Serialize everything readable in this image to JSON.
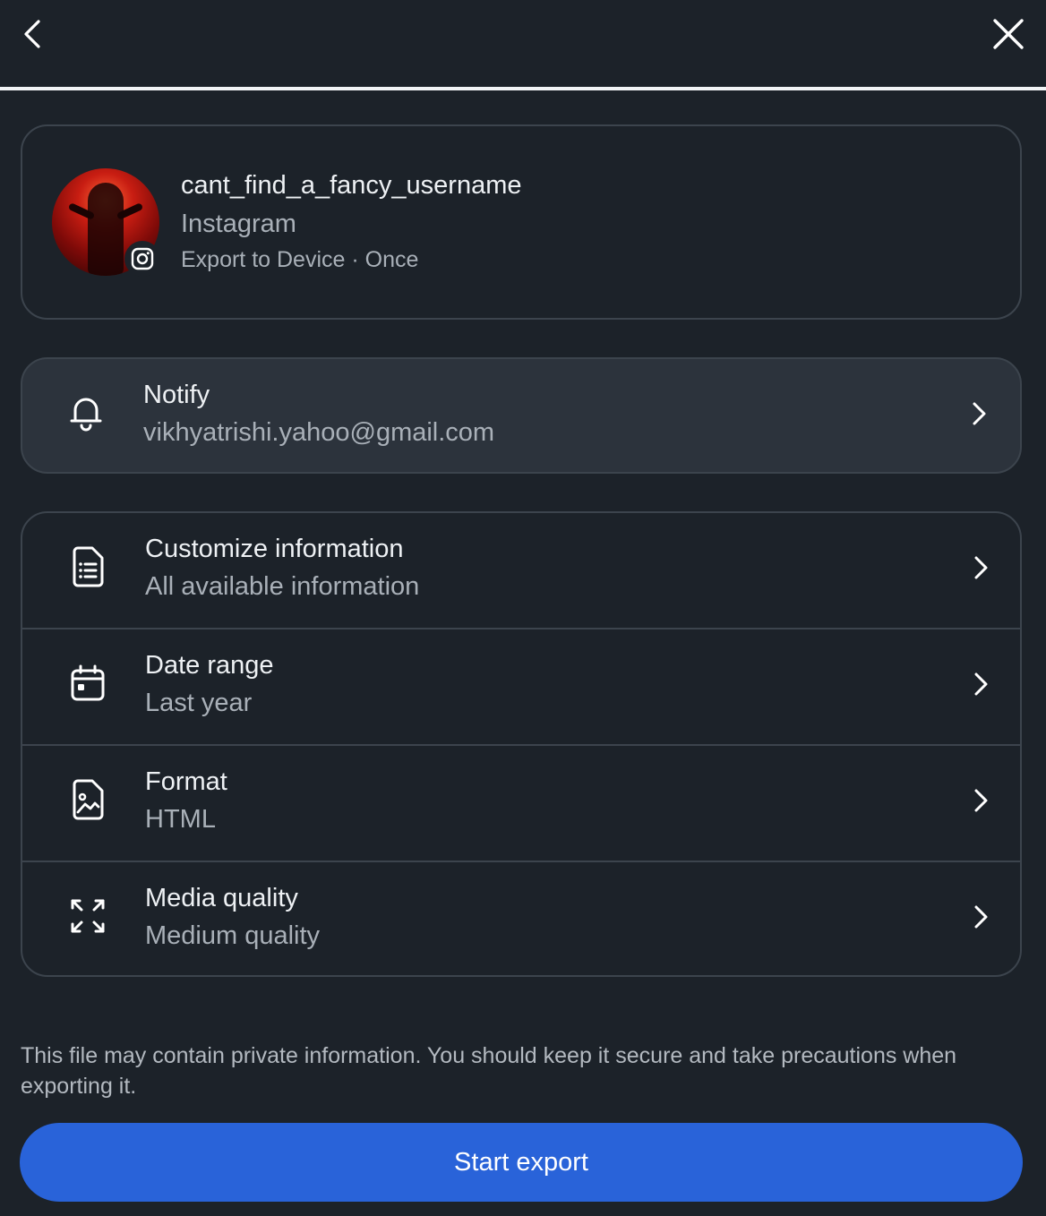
{
  "header": {
    "back_icon": "chevron-left-icon",
    "close_icon": "close-icon",
    "progress": 1.0
  },
  "account": {
    "username": "cant_find_a_fancy_username",
    "platform": "Instagram",
    "destination": "Export to Device · Once",
    "badge_icon": "instagram-icon"
  },
  "notify": {
    "title": "Notify",
    "email": "vikhyatrishi.yahoo@gmail.com",
    "icon": "bell-icon"
  },
  "options": [
    {
      "title": "Customize information",
      "value": "All available information",
      "icon": "document-list-icon"
    },
    {
      "title": "Date range",
      "value": "Last year",
      "icon": "calendar-icon"
    },
    {
      "title": "Format",
      "value": "HTML",
      "icon": "image-file-icon"
    },
    {
      "title": "Media quality",
      "value": "Medium quality",
      "icon": "expand-arrows-icon"
    }
  ],
  "disclaimer": "This file may contain private information. You should keep it secure and take precautions when exporting it.",
  "start_export_label": "Start export",
  "colors": {
    "background": "#1c2229",
    "card_border": "#3c444d",
    "notify_bg": "#2c333c",
    "primary": "#2963d9"
  }
}
